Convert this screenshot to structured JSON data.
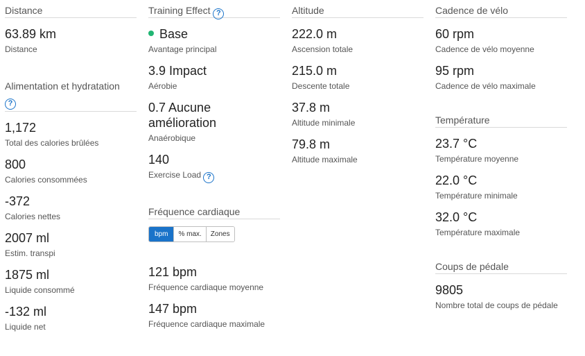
{
  "col1": {
    "distance": {
      "title": "Distance",
      "value": "63.89 km",
      "label": "Distance"
    },
    "nutrition": {
      "title": "Alimentation et hydratation",
      "items": [
        {
          "value": "1,172",
          "label": "Total des calories brûlées"
        },
        {
          "value": "800",
          "label": "Calories consommées"
        },
        {
          "value": "-372",
          "label": "Calories nettes"
        },
        {
          "value": "2007 ml",
          "label": "Estim. transpi"
        },
        {
          "value": "1875 ml",
          "label": "Liquide consommé"
        },
        {
          "value": "-132 ml",
          "label": "Liquide net"
        }
      ]
    }
  },
  "col2": {
    "training": {
      "title": "Training Effect",
      "items": [
        {
          "value": "Base",
          "label": "Avantage principal"
        },
        {
          "value": "3.9 Impact",
          "label": "Aérobie"
        },
        {
          "value_line1": "0.7 Aucune",
          "value_line2": "amélioration",
          "label": "Anaérobique"
        },
        {
          "value": "140",
          "label": "Exercise Load"
        }
      ]
    },
    "heart": {
      "title": "Fréquence cardiaque",
      "toggle": [
        "bpm",
        "% max.",
        "Zones"
      ],
      "items": [
        {
          "value": "121 bpm",
          "label": "Fréquence cardiaque moyenne"
        },
        {
          "value": "147 bpm",
          "label": "Fréquence cardiaque maximale"
        }
      ]
    }
  },
  "col3": {
    "altitude": {
      "title": "Altitude",
      "items": [
        {
          "value": "222.0 m",
          "label": "Ascension totale"
        },
        {
          "value": "215.0 m",
          "label": "Descente totale"
        },
        {
          "value": "37.8 m",
          "label": "Altitude minimale"
        },
        {
          "value": "79.8 m",
          "label": "Altitude maximale"
        }
      ]
    }
  },
  "col4": {
    "cadence": {
      "title": "Cadence de vélo",
      "items": [
        {
          "value": "60 rpm",
          "label": "Cadence de vélo moyenne"
        },
        {
          "value": "95 rpm",
          "label": "Cadence de vélo maximale"
        }
      ]
    },
    "temperature": {
      "title": "Température",
      "items": [
        {
          "value": "23.7 °C",
          "label": "Température moyenne"
        },
        {
          "value": "22.0 °C",
          "label": "Température minimale"
        },
        {
          "value": "32.0 °C",
          "label": "Température maximale"
        }
      ]
    },
    "pedal": {
      "title": "Coups de pédale",
      "items": [
        {
          "value": "9805",
          "label": "Nombre total de coups de pédale"
        }
      ]
    }
  },
  "help_glyph": "?",
  "colors": {
    "accent": "#1a73c9",
    "dot": "#21b573"
  }
}
